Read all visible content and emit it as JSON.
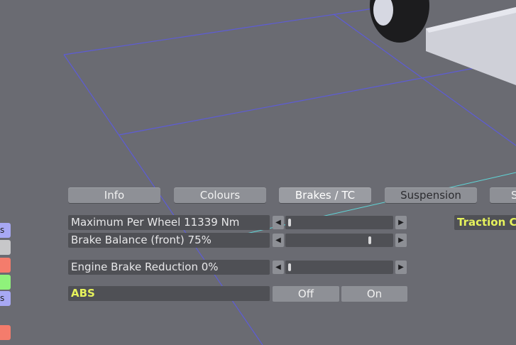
{
  "tabs": [
    {
      "label": "Info"
    },
    {
      "label": "Colours"
    },
    {
      "label": "Brakes / TC"
    },
    {
      "label": "Suspension"
    },
    {
      "label": "S"
    }
  ],
  "rows": {
    "max_per_wheel": {
      "label": "Maximum Per Wheel 11339 Nm",
      "fraction": 0.03
    },
    "brake_balance": {
      "label": "Brake Balance (front) 75%",
      "fraction": 0.75
    },
    "engine_brake": {
      "label": "Engine Brake Reduction 0%",
      "fraction": 0.0
    },
    "abs": {
      "label": "ABS",
      "off_label": "Off",
      "on_label": "On"
    }
  },
  "traction_label": "Traction Co",
  "side_chips": [
    {
      "label": "s",
      "color": "#a7a8f4"
    },
    {
      "label": "",
      "color": "#c7c7c9"
    },
    {
      "label": "",
      "color": "#f47c6c"
    },
    {
      "label": "",
      "color": "#8ff27b"
    },
    {
      "label": "s",
      "color": "#a7a8f4"
    },
    {
      "label": "",
      "color": "#f47c6c"
    }
  ],
  "colors": {
    "background": "#6a6b72",
    "accent_text": "#e6f25c",
    "grid_line": "#5d5cd6",
    "ray_line": "#5fd6d8"
  },
  "icons": {
    "left": "arrow-left-icon",
    "right": "arrow-right-icon"
  }
}
